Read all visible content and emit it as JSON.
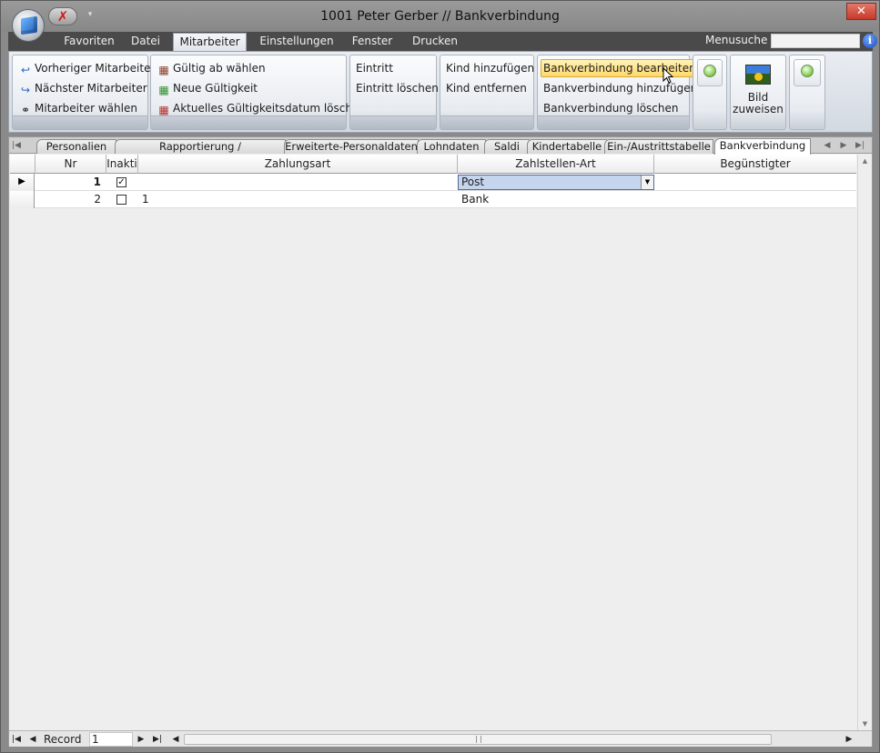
{
  "window": {
    "title": "1001 Peter Gerber // Bankverbindung"
  },
  "quick_access": {
    "undo_icon": "red-x-icon",
    "dropdown_glyph": "▾"
  },
  "ribbon": {
    "tabs": [
      "Favoriten",
      "Datei",
      "Mitarbeiter",
      "Einstellungen",
      "Fenster",
      "Drucken"
    ],
    "active_tab": "Mitarbeiter",
    "menusuche_label": "Menusuche",
    "menusuche_value": "",
    "groups": {
      "navigation": {
        "prev": "Vorheriger Mitarbeiter",
        "next": "Nächster Mitarbeiter",
        "choose": "Mitarbeiter wählen"
      },
      "validity": {
        "choose_from": "Gültig ab wählen",
        "new": "Neue Gültigkeit",
        "delete_current": "Aktuelles Gültigkeitsdatum löschen"
      },
      "entry": {
        "add": "Eintritt",
        "delete": "Eintritt löschen"
      },
      "child": {
        "add": "Kind hinzufügen",
        "remove": "Kind entfernen"
      },
      "bank": {
        "edit": "Bankverbindung bearbeiten",
        "add": "Bankverbindung hinzufügen",
        "delete": "Bankverbindung löschen"
      },
      "picture": {
        "assign": "Bild zuweisen"
      }
    }
  },
  "doc_tabs": {
    "items": [
      "Personalien",
      "Rapportierung / Kostenrechnung",
      "Erweiterte-Personaldaten",
      "Lohndaten",
      "Saldi",
      "Kindertabelle",
      "Ein-/Austrittstabelle",
      "Bankverbindung"
    ],
    "active": "Bankverbindung"
  },
  "grid": {
    "columns": [
      "Nr",
      "Inakti",
      "Zahlungsart",
      "Zahlstellen-Art",
      "Begünstigter"
    ],
    "rows": [
      {
        "nr": "1",
        "inaktiv": true,
        "zahlungsart": "",
        "zahlstellen_art": "Post",
        "beguenstigter": ""
      },
      {
        "nr": "2",
        "inaktiv": false,
        "zahlungsart": "1",
        "zahlstellen_art": "Bank",
        "beguenstigter": ""
      }
    ]
  },
  "record_nav": {
    "label": "Record",
    "value": "1"
  },
  "colors": {
    "ribbon_dark": "#4a4a4a",
    "hover_yellow": "#ffd86a",
    "selection_blue": "#c6d5ee",
    "close_red": "#c7392a"
  }
}
